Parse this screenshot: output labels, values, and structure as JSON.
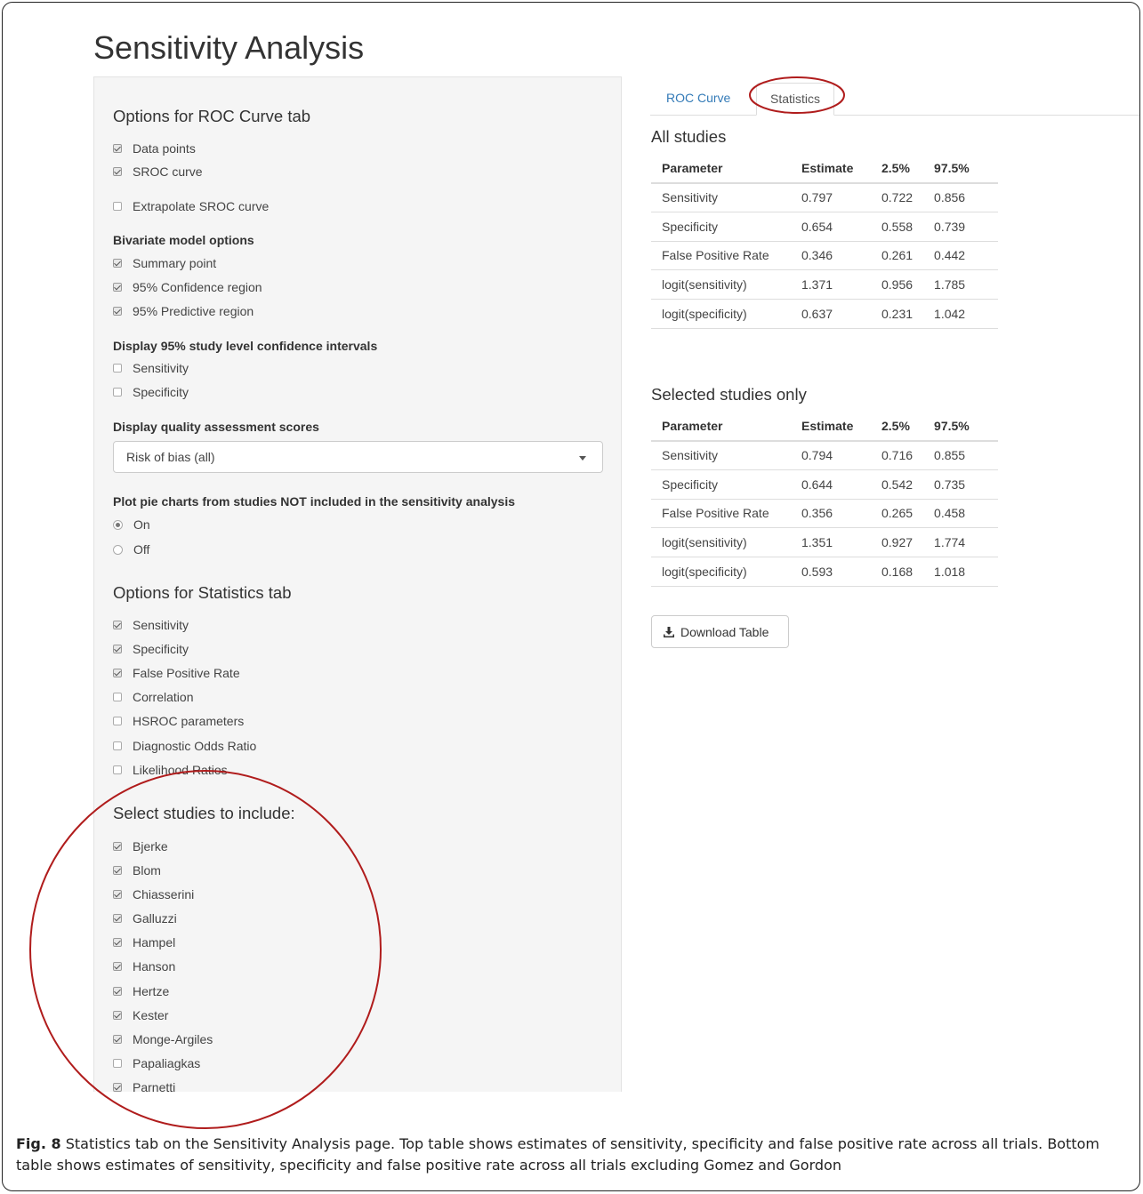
{
  "page_title": "Sensitivity Analysis",
  "roc_options": {
    "heading": "Options for ROC Curve tab",
    "data_points": {
      "label": "Data points",
      "checked": true
    },
    "sroc_curve": {
      "label": "SROC curve",
      "checked": true
    },
    "extrapolate": {
      "label": "Extrapolate SROC curve",
      "checked": false
    },
    "bivariate_label": "Bivariate model options",
    "bivariate": [
      {
        "label": "Summary point",
        "checked": true
      },
      {
        "label": "95% Confidence region",
        "checked": true
      },
      {
        "label": "95% Predictive region",
        "checked": true
      }
    ],
    "ci_label": "Display 95% study level confidence intervals",
    "ci": [
      {
        "label": "Sensitivity",
        "checked": false
      },
      {
        "label": "Specificity",
        "checked": false
      }
    ],
    "quality_label": "Display quality assessment scores",
    "quality_select": "Risk of bias (all)",
    "pie_label": "Plot pie charts from studies NOT included in the sensitivity analysis",
    "pie": [
      {
        "label": "On",
        "checked": true
      },
      {
        "label": "Off",
        "checked": false
      }
    ]
  },
  "stats_options": {
    "heading": "Options for Statistics tab",
    "items": [
      {
        "label": "Sensitivity",
        "checked": true
      },
      {
        "label": "Specificity",
        "checked": true
      },
      {
        "label": "False Positive Rate",
        "checked": true
      },
      {
        "label": "Correlation",
        "checked": false
      },
      {
        "label": "HSROC parameters",
        "checked": false
      },
      {
        "label": "Diagnostic Odds Ratio",
        "checked": false
      },
      {
        "label": "Likelihood Ratios",
        "checked": false
      }
    ]
  },
  "studies": {
    "heading": "Select studies to include:",
    "items": [
      {
        "label": "Bjerke",
        "checked": true
      },
      {
        "label": "Blom",
        "checked": true
      },
      {
        "label": "Chiasserini",
        "checked": true
      },
      {
        "label": "Galluzzi",
        "checked": true
      },
      {
        "label": "Hampel",
        "checked": true
      },
      {
        "label": "Hanson",
        "checked": true
      },
      {
        "label": "Hertze",
        "checked": true
      },
      {
        "label": "Kester",
        "checked": true
      },
      {
        "label": "Monge-Argiles",
        "checked": true
      },
      {
        "label": "Papaliagkas",
        "checked": false
      },
      {
        "label": "Parnetti",
        "checked": true
      }
    ]
  },
  "tabs": [
    {
      "label": "ROC Curve",
      "active": false
    },
    {
      "label": "Statistics",
      "active": true
    }
  ],
  "all_studies": {
    "title": "All studies",
    "headers": [
      "Parameter",
      "Estimate",
      "2.5%",
      "97.5%"
    ],
    "rows": [
      [
        "Sensitivity",
        "0.797",
        "0.722",
        "0.856"
      ],
      [
        "Specificity",
        "0.654",
        "0.558",
        "0.739"
      ],
      [
        "False Positive Rate",
        "0.346",
        "0.261",
        "0.442"
      ],
      [
        "logit(sensitivity)",
        "1.371",
        "0.956",
        "1.785"
      ],
      [
        "logit(specificity)",
        "0.637",
        "0.231",
        "1.042"
      ]
    ]
  },
  "selected_studies": {
    "title": "Selected studies only",
    "headers": [
      "Parameter",
      "Estimate",
      "2.5%",
      "97.5%"
    ],
    "rows": [
      [
        "Sensitivity",
        "0.794",
        "0.716",
        "0.855"
      ],
      [
        "Specificity",
        "0.644",
        "0.542",
        "0.735"
      ],
      [
        "False Positive Rate",
        "0.356",
        "0.265",
        "0.458"
      ],
      [
        "logit(sensitivity)",
        "1.351",
        "0.927",
        "1.774"
      ],
      [
        "logit(specificity)",
        "0.593",
        "0.168",
        "1.018"
      ]
    ]
  },
  "download_label": "Download Table",
  "caption": {
    "prefix": "Fig. 8",
    "text": " Statistics tab on the Sensitivity Analysis page. Top table shows estimates of sensitivity, specificity and false positive rate across all trials. Bottom table shows estimates of sensitivity, specificity and false positive rate across all trials excluding Gomez and Gordon"
  },
  "colors": {
    "annotation": "#b01c1c",
    "link": "#337ab7",
    "panel": "#f5f5f5"
  }
}
